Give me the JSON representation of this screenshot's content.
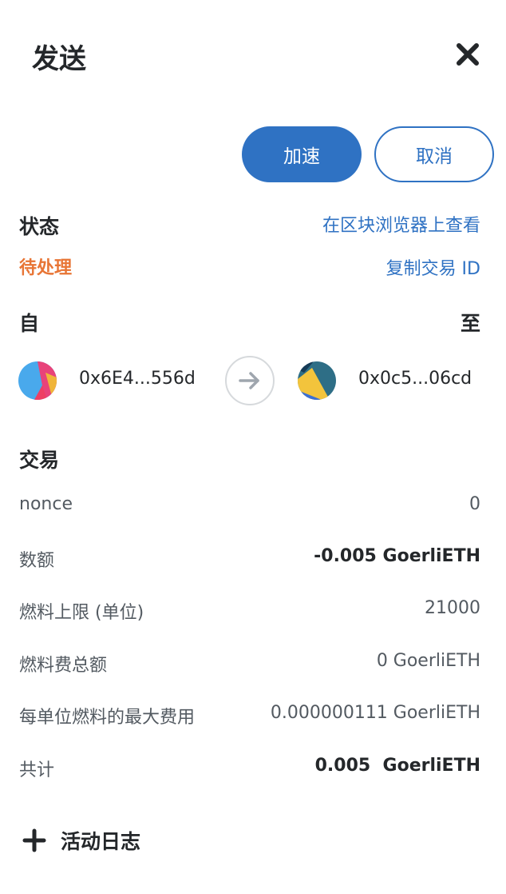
{
  "header": {
    "title": "发送"
  },
  "actions": {
    "speed_up": "加速",
    "cancel": "取消"
  },
  "status": {
    "label": "状态",
    "value": "待处理",
    "explorer_link": "在区块浏览器上查看",
    "copy_link": "复制交易 ID"
  },
  "parties": {
    "from_label": "自",
    "to_label": "至",
    "from_address": "0x6E4...556d",
    "to_address": "0x0c5...06cd"
  },
  "transaction": {
    "title": "交易",
    "rows": [
      {
        "label": "nonce",
        "value": "0"
      },
      {
        "label": "数额",
        "value": "-0.005 GoerliETH"
      },
      {
        "label": "燃料上限 (单位)",
        "value": "21000"
      },
      {
        "label": "燃料费总额",
        "value": "0 GoerliETH"
      },
      {
        "label": "每单位燃料的最大费用",
        "value": "0.000000111 GoerliETH"
      },
      {
        "label": "共计",
        "value": "0.005  GoerliETH"
      }
    ]
  },
  "activity_log": {
    "label": "活动日志"
  },
  "colors": {
    "accent": "#2f72c3",
    "pending": "#e87535",
    "text": "#24272a",
    "muted": "#535a61"
  },
  "icons": [
    "close-icon",
    "from-identicon",
    "arrow-right-icon",
    "to-identicon",
    "plus-icon"
  ]
}
